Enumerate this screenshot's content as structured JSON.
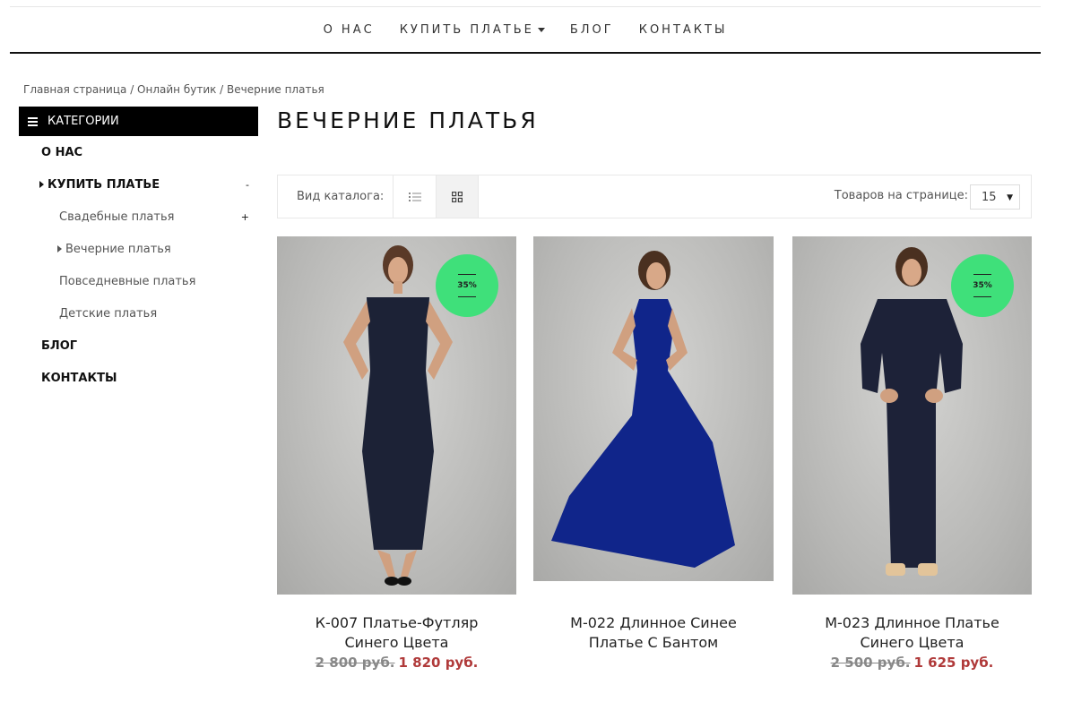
{
  "nav": {
    "items": [
      "О НАС",
      "КУПИТЬ ПЛАТЬЕ",
      "БЛОГ",
      "КОНТАКТЫ"
    ]
  },
  "breadcrumb": {
    "items": [
      "Главная страница",
      "Онлайн бутик",
      "Вечерние платья"
    ],
    "separator": " / "
  },
  "sidebar": {
    "header": "КАТЕГОРИИ",
    "items": [
      {
        "label": "О НАС"
      },
      {
        "label": "КУПИТЬ ПЛАТЬЕ",
        "toggle": "-"
      },
      {
        "label": "Свадебные платья",
        "toggle": "+"
      },
      {
        "label": "Вечерние платья"
      },
      {
        "label": "Повседневные платья"
      },
      {
        "label": "Детские платья"
      },
      {
        "label": "БЛОГ"
      },
      {
        "label": "КОНТАКТЫ"
      }
    ]
  },
  "page": {
    "title": "ВЕЧЕРНИЕ ПЛАТЬЯ"
  },
  "toolbar": {
    "view_label": "Вид каталога:",
    "view_modes": [
      "list-icon",
      "grid-icon"
    ],
    "active_view": "grid",
    "per_page_label": "Товаров на странице:",
    "per_page_value": "15"
  },
  "products": [
    {
      "name": "К-007 Платье-Футляр Синего Цвета",
      "old_price": "2 800 руб.",
      "new_price": "1 820 руб.",
      "badge": "35%",
      "dress_color": "#1c2236"
    },
    {
      "name": "М-022 Длинное Синее Платье С Бантом",
      "old_price": "",
      "new_price": "",
      "badge": "",
      "dress_color": "#10258a"
    },
    {
      "name": "М-023 Длинное Платье Синего Цвета",
      "old_price": "2 500 руб.",
      "new_price": "1 625 руб.",
      "badge": "35%",
      "dress_color": "#1d2238"
    }
  ],
  "colors": {
    "badge": "#3fe07a",
    "sale_price": "#b03a3a",
    "header_bg": "#000000"
  }
}
